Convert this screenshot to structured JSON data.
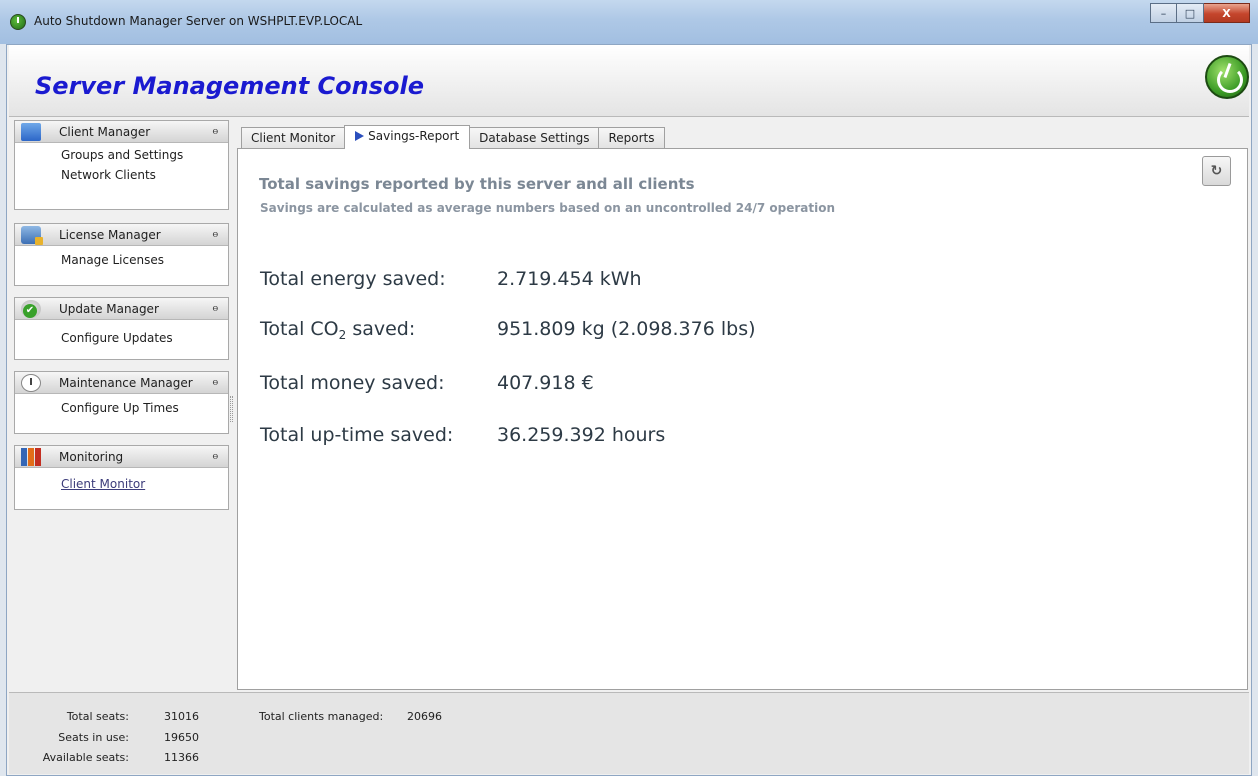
{
  "window": {
    "title": "Auto Shutdown Manager Server on WSHPLT.EVP.LOCAL",
    "minimize": "–",
    "maximize": "□",
    "close": "X"
  },
  "header": {
    "title": "Server Management Console"
  },
  "sidebar": {
    "groups": [
      {
        "label": "Client Manager",
        "icon": "client-manager-icon",
        "items": [
          "Groups and Settings",
          "Network Clients"
        ]
      },
      {
        "label": "License Manager",
        "icon": "license-manager-icon",
        "items": [
          "Manage Licenses"
        ]
      },
      {
        "label": "Update  Manager",
        "icon": "update-manager-icon",
        "items": [
          "Configure Updates"
        ]
      },
      {
        "label": "Maintenance Manager",
        "icon": "maintenance-clock-icon",
        "items": [
          "Configure Up Times"
        ]
      },
      {
        "label": "Monitoring",
        "icon": "monitoring-chart-icon",
        "items": [
          "Client Monitor"
        ]
      }
    ],
    "collapse_glyph": "ⲑ"
  },
  "tabs": [
    {
      "label": "Client Monitor",
      "active": false
    },
    {
      "label": "Savings-Report",
      "active": true
    },
    {
      "label": "Database Settings",
      "active": false
    },
    {
      "label": "Reports",
      "active": false
    }
  ],
  "report": {
    "refresh_glyph": "↻",
    "title": "Total savings reported by this server and all clients",
    "subtitle": "Savings are calculated as average numbers based on an uncontrolled 24/7 operation",
    "energy": {
      "label": "Total energy saved:",
      "value": "2.719.454 kWh"
    },
    "co2": {
      "label_prefix": "Total CO",
      "label_sub": "2",
      "label_suffix": " saved:",
      "value": "951.809 kg (2.098.376 lbs)"
    },
    "money": {
      "label": "Total money saved:",
      "value": "407.918 €"
    },
    "uptime": {
      "label": "Total up-time saved:",
      "value": "36.259.392 hours"
    }
  },
  "status": {
    "total_seats_label": "Total seats:",
    "total_seats": "31016",
    "seats_in_use_label": "Seats in use:",
    "seats_in_use": "19650",
    "available_seats_label": "Available seats:",
    "available_seats": "11366",
    "clients_managed_label": "Total clients managed:",
    "clients_managed": "20696"
  },
  "colors": {
    "console_title": "#1a1ad0",
    "accent_tab_arrow": "#2b4fbd"
  }
}
